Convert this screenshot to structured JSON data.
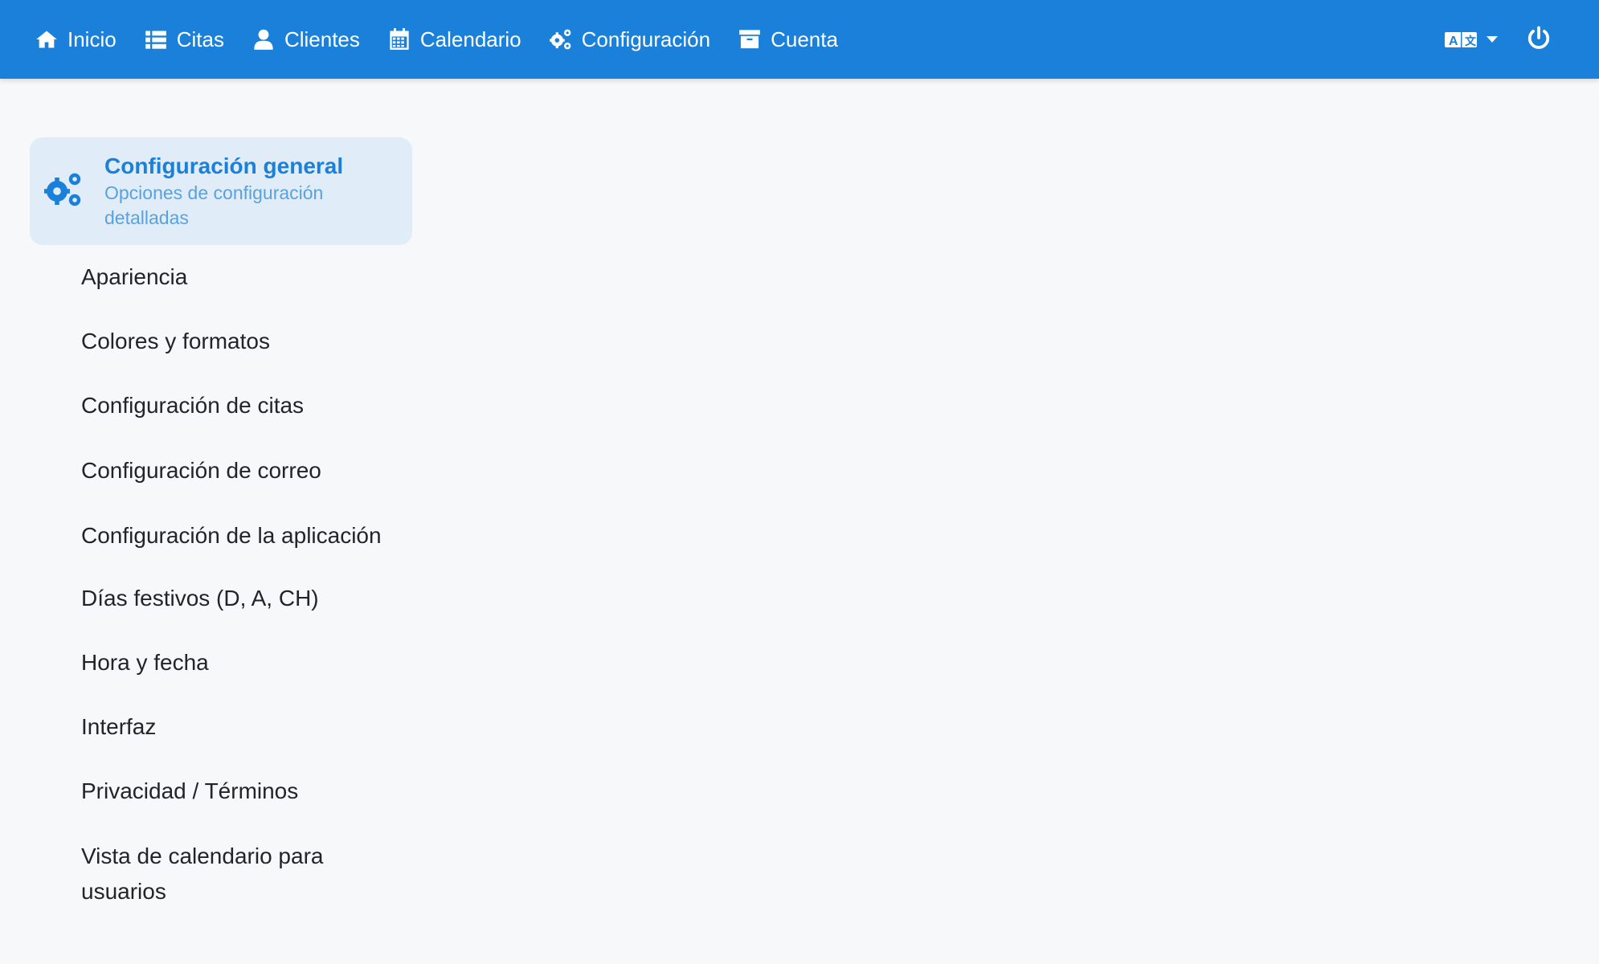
{
  "nav": {
    "items": [
      {
        "label": "Inicio",
        "icon": "home-icon"
      },
      {
        "label": "Citas",
        "icon": "list-icon"
      },
      {
        "label": "Clientes",
        "icon": "user-icon"
      },
      {
        "label": "Calendario",
        "icon": "calendar-icon"
      },
      {
        "label": "Configuración",
        "icon": "cogs-icon"
      },
      {
        "label": "Cuenta",
        "icon": "archive-icon"
      }
    ],
    "language_icon": "language-icon",
    "power_icon": "power-icon"
  },
  "sidebar": {
    "active": {
      "title": "Configuración general",
      "subtitle": "Opciones de configuración detalladas",
      "icon": "cogs-icon"
    },
    "items": [
      {
        "label": "Apariencia"
      },
      {
        "label": "Colores y formatos"
      },
      {
        "label": "Configuración de citas"
      },
      {
        "label": "Configuración de correo"
      },
      {
        "label": "Configuración de la aplicación"
      },
      {
        "label": "Días festivos (D, A, CH)"
      },
      {
        "label": "Hora y fecha"
      },
      {
        "label": "Interfaz"
      },
      {
        "label": "Privacidad / Términos"
      },
      {
        "label": "Vista de calendario para usuarios"
      }
    ]
  },
  "colors": {
    "navbar": "#1a80d9",
    "active_card": "#e0ecf7",
    "accent": "#1a80d9",
    "subtitle": "#5aa2de",
    "background": "#f7f8fa"
  }
}
